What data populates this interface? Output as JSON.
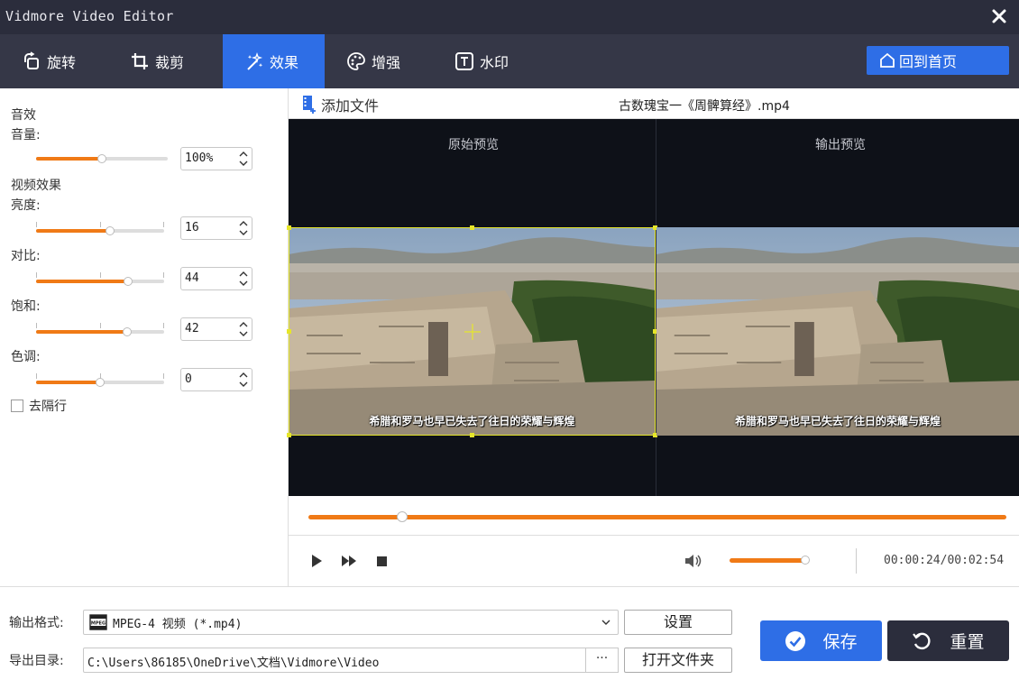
{
  "window": {
    "title": "Vidmore Video Editor"
  },
  "tabs": [
    {
      "label": "旋转",
      "icon": "rotate-icon"
    },
    {
      "label": "裁剪",
      "icon": "crop-icon"
    },
    {
      "label": "效果",
      "icon": "effects-icon",
      "active": true
    },
    {
      "label": "增强",
      "icon": "palette-icon"
    },
    {
      "label": "水印",
      "icon": "watermark-icon"
    }
  ],
  "home_button": {
    "label": "回到首页",
    "icon": "home-icon"
  },
  "audio": {
    "section_title": "音效",
    "volume_label": "音量:",
    "volume_value": "100%",
    "volume_fraction": 0.5
  },
  "video": {
    "section_title": "视频效果",
    "brightness": {
      "label": "亮度:",
      "value": "16",
      "fraction": 0.58
    },
    "contrast": {
      "label": "对比:",
      "value": "44",
      "fraction": 0.72
    },
    "saturation": {
      "label": "饱和:",
      "value": "42",
      "fraction": 0.71
    },
    "hue": {
      "label": "色调:",
      "value": "0",
      "fraction": 0.5
    },
    "deinterlace": {
      "label": "去隔行",
      "checked": false
    }
  },
  "file": {
    "add_label": "添加文件",
    "filename": "古数瑰宝一《周髀算经》.mp4"
  },
  "preview": {
    "original_label": "原始预览",
    "output_label": "输出预览",
    "subtitle": "希腊和罗马也早已失去了往日的荣耀与辉煌"
  },
  "playback": {
    "progress_fraction": 0.135,
    "volume_fraction": 0.96,
    "time": "00:00:24/00:02:54"
  },
  "output": {
    "format_label": "输出格式:",
    "format_value": "MPEG-4 视频 (*.mp4)",
    "settings_label": "设置",
    "dir_label": "导出目录:",
    "dir_value": "C:\\Users\\86185\\OneDrive\\文档\\Vidmore\\Video",
    "browse_label": "···",
    "open_folder_label": "打开文件夹",
    "save_label": "保存",
    "reset_label": "重置"
  },
  "colors": {
    "accent": "#2e6ee6",
    "orange": "#f07a16",
    "titlebar": "#2b2d3c",
    "tabbar": "#353747"
  }
}
